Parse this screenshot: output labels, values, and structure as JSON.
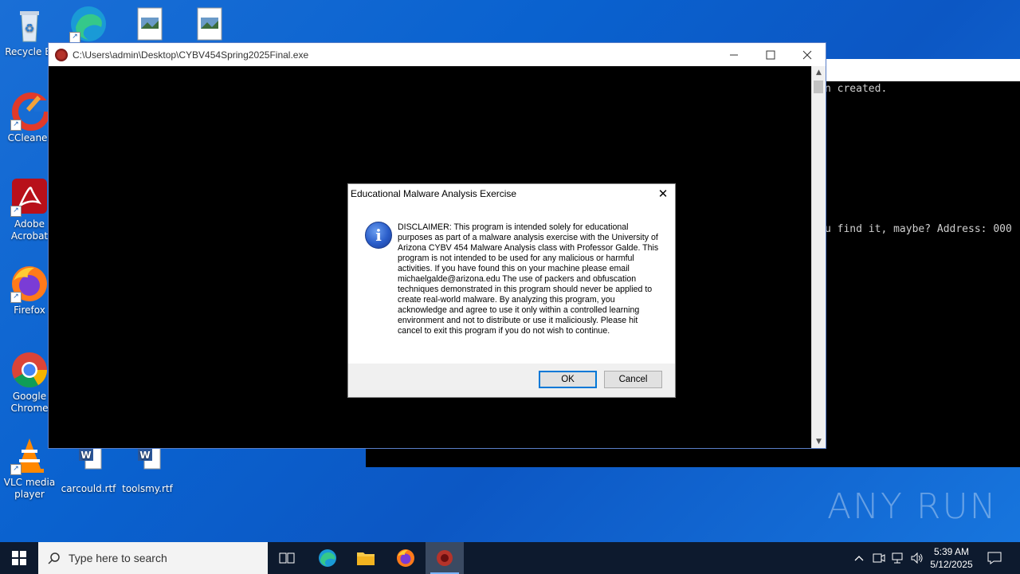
{
  "desktop": {
    "icons": [
      {
        "label": "Recycle Bi"
      },
      {
        "label": "CCleaner"
      },
      {
        "label": "Adobe Acrobat"
      },
      {
        "label": "Firefox"
      },
      {
        "label": "Google Chrome"
      },
      {
        "label": "VLC media player"
      },
      {
        "label": "carcould.rtf"
      },
      {
        "label": "toolsmy.rtf"
      }
    ]
  },
  "background_console": {
    "line1": "n created.",
    "line2": "u find it, maybe? Address: 000"
  },
  "main_window": {
    "title": "C:\\Users\\admin\\Desktop\\CYBV454Spring2025Final.exe"
  },
  "dialog": {
    "title": "Educational Malware Analysis Exercise",
    "message": "DISCLAIMER: This program is intended solely for educational purposes as part of a malware analysis exercise with the University of Arizona CYBV 454 Malware Analysis class with Professor Galde. This program is not intended to be used for any malicious or harmful activities. If you have found this on your machine please email michaelgalde@arizona.edu The use of packers and obfuscation techniques demonstrated in this program should never be applied to create real-world malware. By analyzing this program, you acknowledge and agree to use it only within a controlled learning environment and not to distribute or use it maliciously. Please hit cancel to exit this program if you do not wish to continue.",
    "ok_label": "OK",
    "cancel_label": "Cancel"
  },
  "watermark": "ANY RUN",
  "taskbar": {
    "search_placeholder": "Type here to search",
    "time": "5:39 AM",
    "date": "5/12/2025"
  }
}
